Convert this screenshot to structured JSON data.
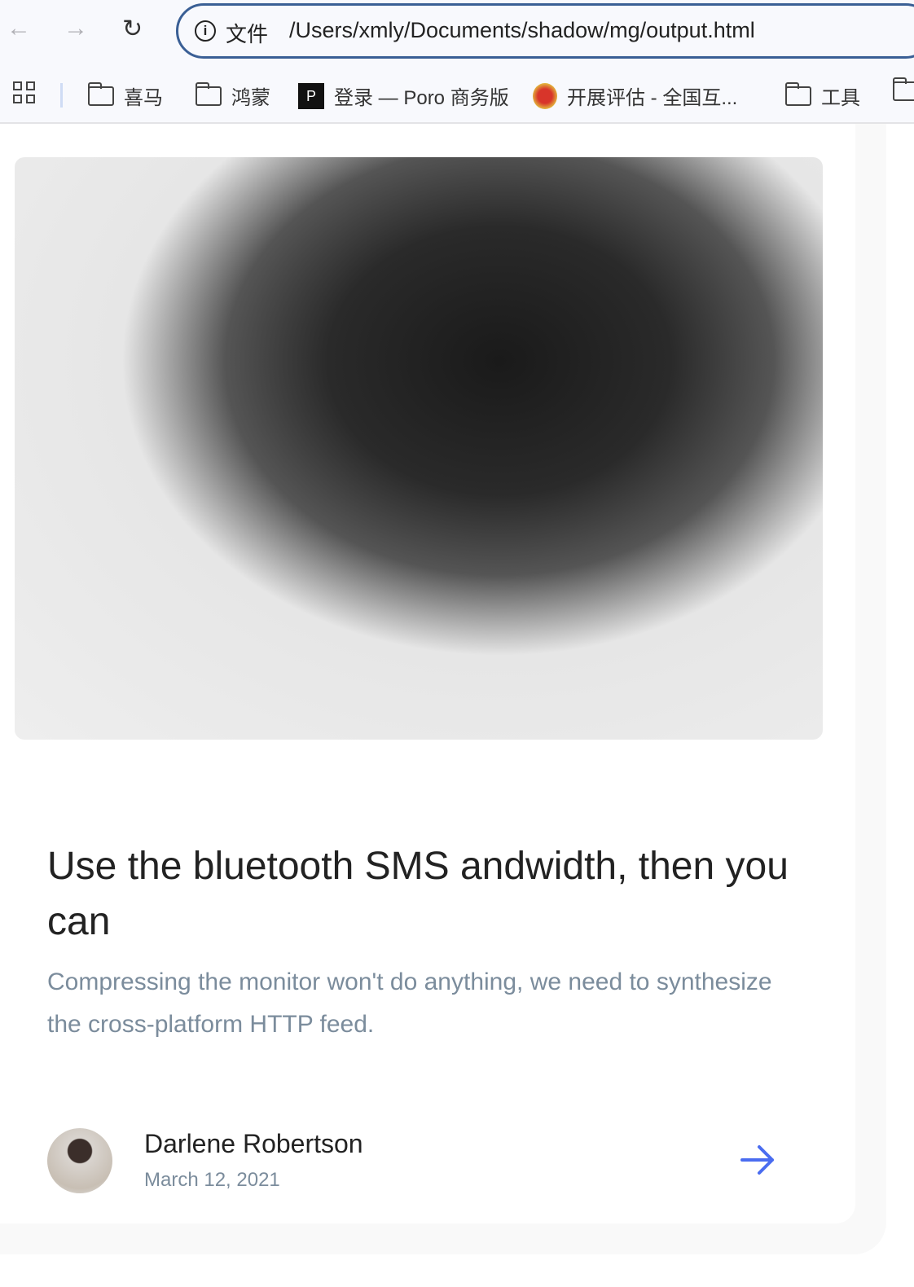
{
  "browser": {
    "address_label": "文件",
    "url": "/Users/xmly/Documents/shadow/mg/output.html",
    "bookmarks": [
      {
        "label": "喜马",
        "icon": "folder-icon"
      },
      {
        "label": "鸿蒙",
        "icon": "folder-icon"
      },
      {
        "label": "登录 — Poro 商务版",
        "icon": "poro-logo-icon"
      },
      {
        "label": "开展评估 - 全国互...",
        "icon": "emblem-icon"
      },
      {
        "label": "工具",
        "icon": "folder-icon"
      }
    ]
  },
  "card": {
    "title": "Use the bluetooth SMS andwidth, then you can",
    "description": "Compressing the monitor won't do anything, we need to synthesize the cross-platform HTTP feed.",
    "author": "Darlene Robertson",
    "date": "March 12, 2021",
    "accent_color": "#4a6cf0"
  }
}
